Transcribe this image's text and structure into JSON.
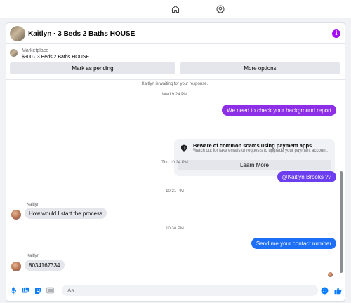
{
  "nav": {
    "home_icon": "home-icon",
    "profile_icon": "profile-icon"
  },
  "header": {
    "title": "Kaitlyn · 3 Beds 2 Baths HOUSE",
    "info_icon": "info-icon",
    "info_glyph": "i"
  },
  "listing": {
    "source": "Marketplace",
    "price_title": "$900 · 3 Beds 2 Baths HOUSE",
    "mark_pending": "Mark as pending",
    "more_options": "More options"
  },
  "thread": {
    "status": "Kaitlyn is waiting for your response.",
    "ts1": "Wed 9:24 PM",
    "msg1": "We need to check your background report",
    "scam": {
      "title": "Beware of common scams using payment apps",
      "desc": "Watch out for fake emails or requests to upgrade your payment account.",
      "button": "Learn More"
    },
    "ts2": "Thu 10:24 PM",
    "msg2": "@Kaitlyn Brooks ??",
    "ts3": "10:21 PM",
    "sender1": "Kaitlyn",
    "msg3": "How would I start the process",
    "ts4": "10:38 PM",
    "msg4": "Send me your contact number",
    "sender2": "Kaitlyn",
    "msg5": "8034167334"
  },
  "composer": {
    "placeholder": "Aa",
    "icons": [
      "microphone-icon",
      "photo-icon",
      "sticker-icon",
      "gif-icon",
      "emoji-icon",
      "like-icon"
    ]
  },
  "colors": {
    "accent_purple": "#8c2fe6",
    "accent_violet": "#6b3ef0",
    "accent_blue": "#1d6ff5",
    "info": "#a40cf5"
  }
}
